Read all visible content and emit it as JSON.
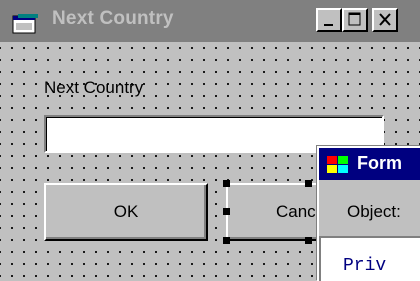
{
  "window": {
    "title": "Next Country",
    "icon": "form-window-icon",
    "caption_buttons": [
      "minimize",
      "maximize",
      "close"
    ]
  },
  "form": {
    "label": "Next Country",
    "textbox_value": "",
    "ok_label": "OK",
    "cancel_label": "Canc"
  },
  "code_window": {
    "title": "Form",
    "object_label": "Object:",
    "code_text": "Priv"
  },
  "colors": {
    "inactive_title": "#808080",
    "active_title": "#000080",
    "face": "#c0c0c0"
  }
}
